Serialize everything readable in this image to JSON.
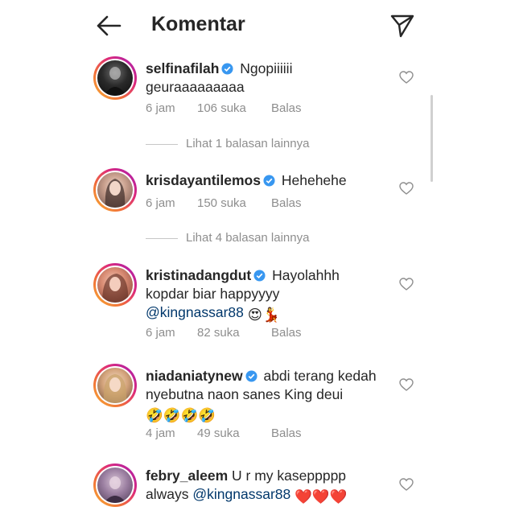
{
  "header": {
    "title": "Komentar",
    "back_icon": "arrow-left-icon",
    "send_icon": "paper-plane-icon"
  },
  "comments": [
    {
      "username": "selfinafilah",
      "text": "Ngopiiiiii geuraaaaaaaaa",
      "time": "6 jam",
      "likes": "106 suka",
      "reply": "Balas",
      "view_replies": "Lihat 1 balasan lainnya"
    },
    {
      "username": "krisdayantilemos",
      "text": "Hehehehe",
      "time": "6 jam",
      "likes": "150 suka",
      "reply": "Balas",
      "view_replies": "Lihat 4 balasan lainnya"
    },
    {
      "username": "kristinadangdut",
      "text": "Hayolahhh kopdar biar happyyyy",
      "mention": "@kingnassar88",
      "emojis": "😍💃",
      "time": "6 jam",
      "likes": "82 suka",
      "reply": "Balas"
    },
    {
      "username": "niadaniatynew",
      "text": "abdi terang kedah nyebutna naon sanes King deui",
      "emojis": "🤣🤣🤣🤣",
      "time": "4 jam",
      "likes": "49 suka",
      "reply": "Balas"
    },
    {
      "username": "febry_aleem",
      "text": "U r my kaseppppp always",
      "mention": "@kingnassar88",
      "emojis": "❤️❤️❤️"
    }
  ],
  "colors": {
    "text": "#262626",
    "meta": "#8e8e8e",
    "mention": "#00376b",
    "verified": "#3897f0"
  }
}
